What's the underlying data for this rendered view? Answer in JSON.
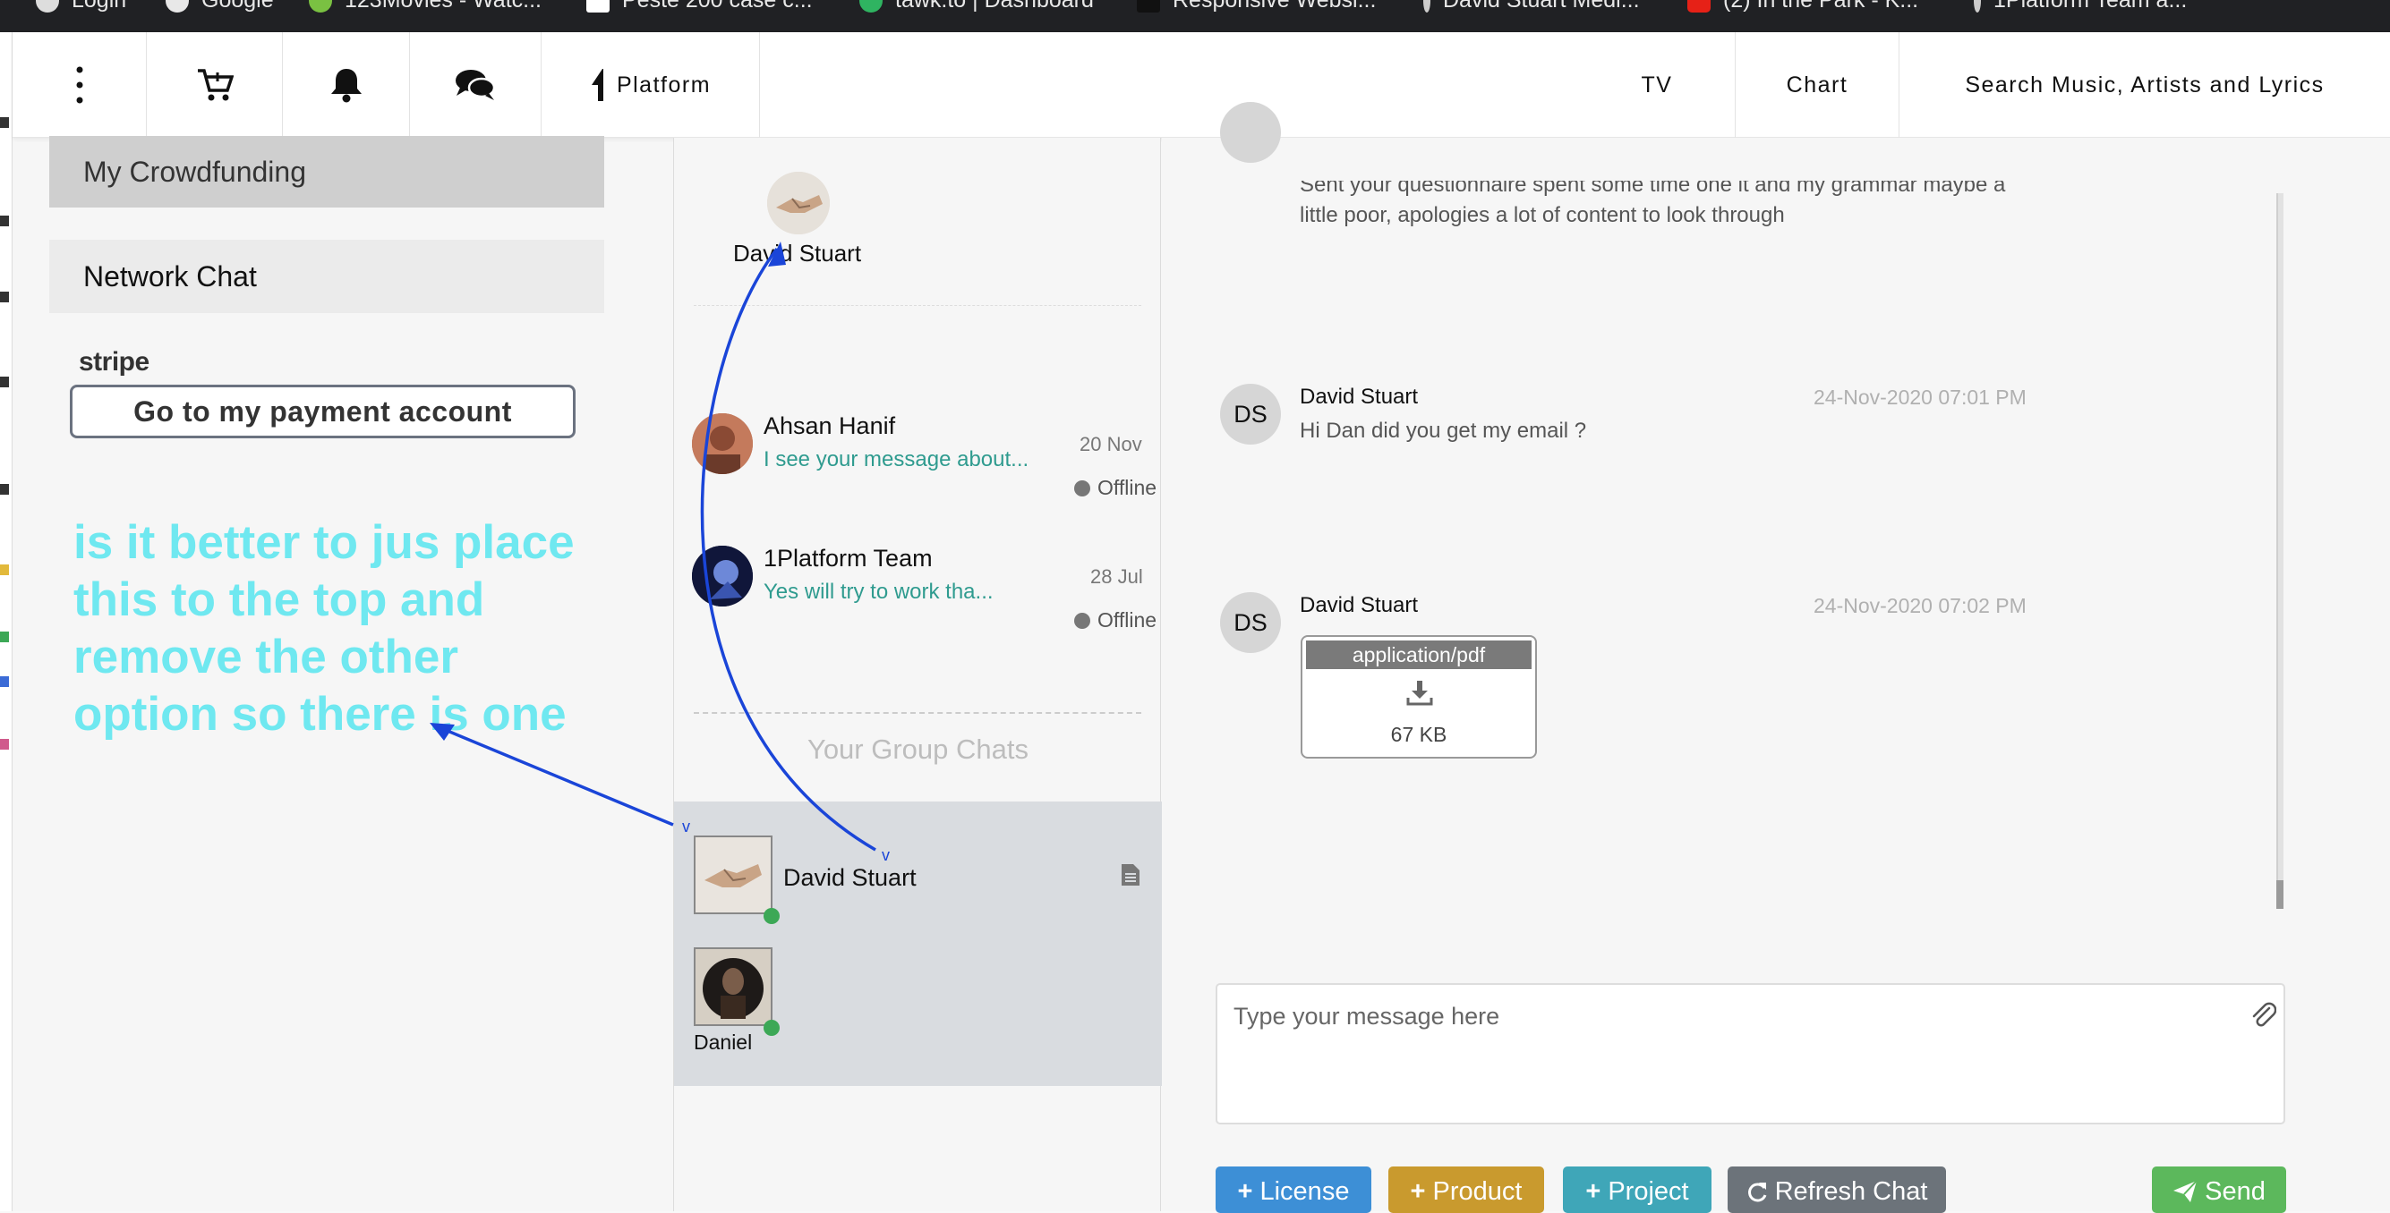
{
  "browser": {
    "bookmarks": [
      "Login",
      "Google",
      "123Movies - Watc...",
      "Peste 200 case c...",
      "tawk.to | Dashboard",
      "Responsive Websi...",
      "David Stuart Medi...",
      "(2) In the Park - K...",
      "1Platform Team a..."
    ]
  },
  "topnav": {
    "platform_label": "Platform",
    "tv_label": "TV",
    "chart_label": "Chart",
    "search_label": "Search Music, Artists and Lyrics"
  },
  "sidebar": {
    "crowdfunding_label": "My Crowdfunding",
    "network_chat_label": "Network Chat",
    "stripe_label": "stripe",
    "payment_button": "Go to my payment account"
  },
  "annotation": {
    "text": "is it better to jus place this to the top and remove the other option so there is one"
  },
  "contacts": {
    "current_user": "David Stuart",
    "list": [
      {
        "name": "Ahsan Hanif",
        "message": "I see your message about...",
        "date": "20 Nov",
        "status": "Offline"
      },
      {
        "name": "1Platform Team",
        "message": "Yes will try to work tha...",
        "date": "28 Jul",
        "status": "Offline"
      }
    ],
    "group_title": "Your Group Chats",
    "groups": [
      {
        "name": "David Stuart"
      },
      {
        "name": "Daniel"
      }
    ]
  },
  "chat": {
    "messages": [
      {
        "text": "Sent your questionnaire spent some time one it and my grammar maybe a little poor, apologies a lot of content to look through"
      },
      {
        "initials": "DS",
        "name": "David Stuart",
        "time": "24-Nov-2020 07:01 PM",
        "text": "Hi Dan did you get my email ?"
      },
      {
        "initials": "DS",
        "name": "David Stuart",
        "time": "24-Nov-2020 07:02 PM",
        "file_type": "application/pdf",
        "file_size": "67 KB"
      }
    ],
    "composer_placeholder": "Type your message here",
    "buttons": {
      "license": "License",
      "product": "Product",
      "project": "Project",
      "refresh": "Refresh Chat",
      "send": "Send"
    }
  },
  "colors": {
    "annotation": "#6fe8f0",
    "arrow": "#1a45d8",
    "license": "#3d8fd6",
    "product": "#c99a2e",
    "project": "#3fa6b8",
    "refresh": "#6c737a",
    "send": "#5cb85c"
  }
}
